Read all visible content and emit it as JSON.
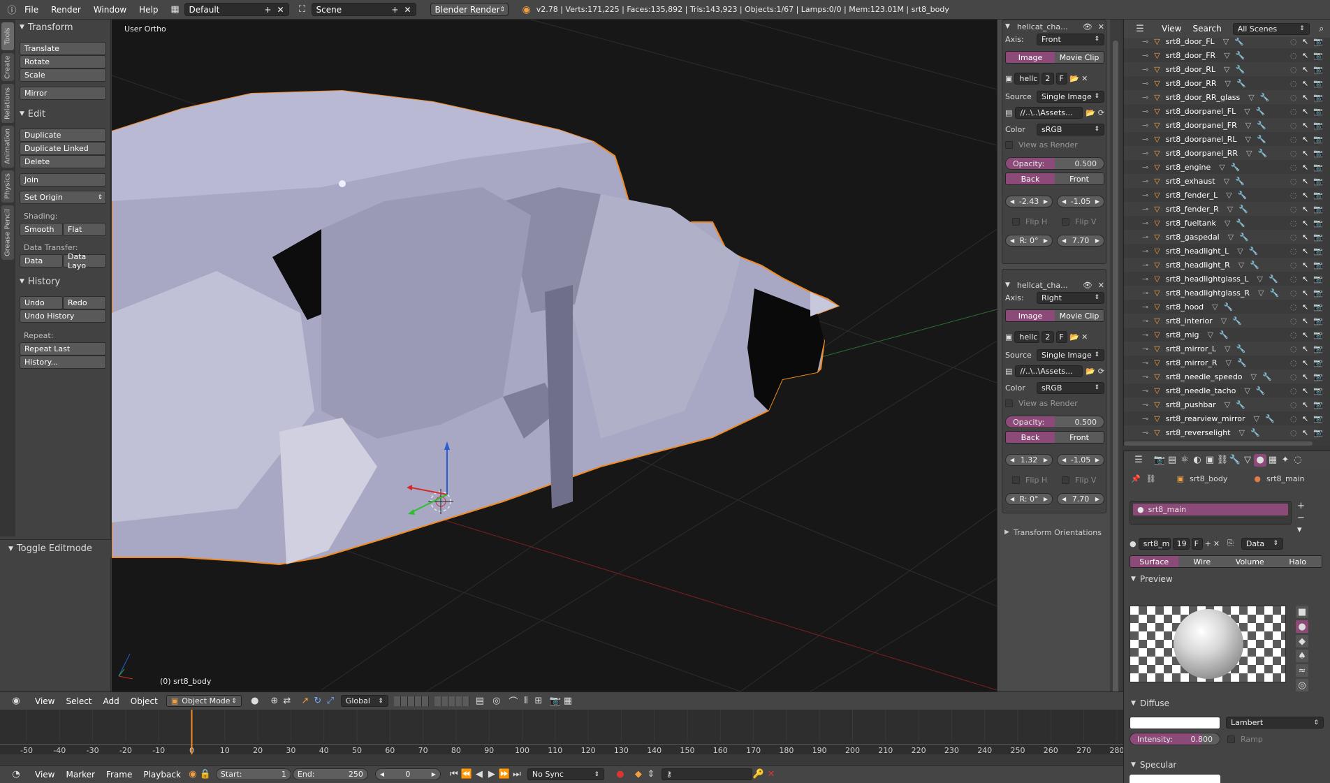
{
  "topbar": {
    "menus": [
      "File",
      "Render",
      "Window",
      "Help"
    ],
    "layout_name": "Default",
    "scene_name": "Scene",
    "engine": "Blender Render",
    "stats": "v2.78 | Verts:171,225 | Faces:135,892 | Tris:143,923 | Objects:1/67 | Lamps:0/0 | Mem:123.01M | srt8_body"
  },
  "vtabs": [
    "Tools",
    "Create",
    "Relations",
    "Animation",
    "Physics",
    "Grease Pencil"
  ],
  "tools": {
    "transform_header": "Transform",
    "translate": "Translate",
    "rotate": "Rotate",
    "scale": "Scale",
    "mirror": "Mirror",
    "edit_header": "Edit",
    "duplicate": "Duplicate",
    "duplicate_linked": "Duplicate Linked",
    "delete": "Delete",
    "join": "Join",
    "set_origin": "Set Origin",
    "shading_label": "Shading:",
    "smooth": "Smooth",
    "flat": "Flat",
    "data_transfer_label": "Data Transfer:",
    "data": "Data",
    "data_layo": "Data Layo",
    "history_header": "History",
    "undo": "Undo",
    "redo": "Redo",
    "undo_history": "Undo History",
    "repeat_label": "Repeat:",
    "repeat_last": "Repeat Last",
    "history": "History...",
    "toggle_editmode": "Toggle Editmode"
  },
  "viewport": {
    "view_label": "User Ortho",
    "object_label": "(0) srt8_body"
  },
  "bg_images": [
    {
      "name": "hellcat_cha...",
      "axis_label": "Axis:",
      "axis": "Front",
      "tab_image": "Image",
      "tab_movieclip": "Movie Clip",
      "img_name": "hellc",
      "img_users": "2",
      "fake": "F",
      "source_label": "Source",
      "source": "Single Image",
      "path": "//..\\..\\Assets...",
      "color_label": "Color",
      "color": "sRGB",
      "view_as_render": "View as Render",
      "opacity_label": "Opacity:",
      "opacity": "0.500",
      "back": "Back",
      "front": "Front",
      "offset_x": "-2.43",
      "offset_y": "-1.05",
      "flip_h": "Flip H",
      "flip_v": "Flip V",
      "rotation": "R: 0°",
      "size": "7.70"
    },
    {
      "name": "hellcat_cha...",
      "axis_label": "Axis:",
      "axis": "Right",
      "tab_image": "Image",
      "tab_movieclip": "Movie Clip",
      "img_name": "hellc",
      "img_users": "2",
      "fake": "F",
      "source_label": "Source",
      "source": "Single Image",
      "path": "//..\\..\\Assets...",
      "color_label": "Color",
      "color": "sRGB",
      "view_as_render": "View as Render",
      "opacity_label": "Opacity:",
      "opacity": "0.500",
      "back": "Back",
      "front": "Front",
      "offset_x": "1.32",
      "offset_y": "-1.05",
      "flip_h": "Flip H",
      "flip_v": "Flip V",
      "rotation": "R: 0°",
      "size": "7.70"
    }
  ],
  "transform_orientations": "Transform Orientations",
  "outliner": {
    "view": "View",
    "search": "Search",
    "scenes": "All Scenes",
    "items": [
      "srt8_door_FL",
      "srt8_door_FR",
      "srt8_door_RL",
      "srt8_door_RR",
      "srt8_door_RR_glass",
      "srt8_doorpanel_FL",
      "srt8_doorpanel_FR",
      "srt8_doorpanel_RL",
      "srt8_doorpanel_RR",
      "srt8_engine",
      "srt8_exhaust",
      "srt8_fender_L",
      "srt8_fender_R",
      "srt8_fueltank",
      "srt8_gaspedal",
      "srt8_headlight_L",
      "srt8_headlight_R",
      "srt8_headlightglass_L",
      "srt8_headlightglass_R",
      "srt8_hood",
      "srt8_interior",
      "srt8_mig",
      "srt8_mirror_L",
      "srt8_mirror_R",
      "srt8_needle_speedo",
      "srt8_needle_tacho",
      "srt8_pushbar",
      "srt8_rearview_mirror",
      "srt8_reverselight"
    ]
  },
  "properties": {
    "object_name": "srt8_body",
    "material_name": "srt8_main",
    "slot_name": "srt8_main",
    "mat_field": "srt8_m",
    "mat_users": "19",
    "fake": "F",
    "data_dropdown": "Data",
    "tabs": [
      "Surface",
      "Wire",
      "Volume",
      "Halo"
    ],
    "preview_header": "Preview",
    "diffuse_header": "Diffuse",
    "diffuse_shader": "Lambert",
    "intensity_label": "Intensity:",
    "intensity": "0.800",
    "ramp": "Ramp",
    "specular_header": "Specular"
  },
  "viewport_header": {
    "menus": [
      "View",
      "Select",
      "Add",
      "Object"
    ],
    "mode": "Object Mode",
    "orientation": "Global"
  },
  "timeline": {
    "ticks": [
      "-50",
      "-40",
      "-30",
      "-20",
      "-10",
      "0",
      "10",
      "20",
      "30",
      "40",
      "50",
      "60",
      "70",
      "80",
      "90",
      "100",
      "110",
      "120",
      "130",
      "140",
      "150",
      "160",
      "170",
      "180",
      "190",
      "200",
      "210",
      "220",
      "230",
      "240",
      "250",
      "260",
      "270",
      "280"
    ],
    "menus": [
      "View",
      "Marker",
      "Frame",
      "Playback"
    ],
    "start_label": "Start:",
    "start": "1",
    "end_label": "End:",
    "end": "250",
    "current": "0",
    "sync": "No Sync"
  }
}
